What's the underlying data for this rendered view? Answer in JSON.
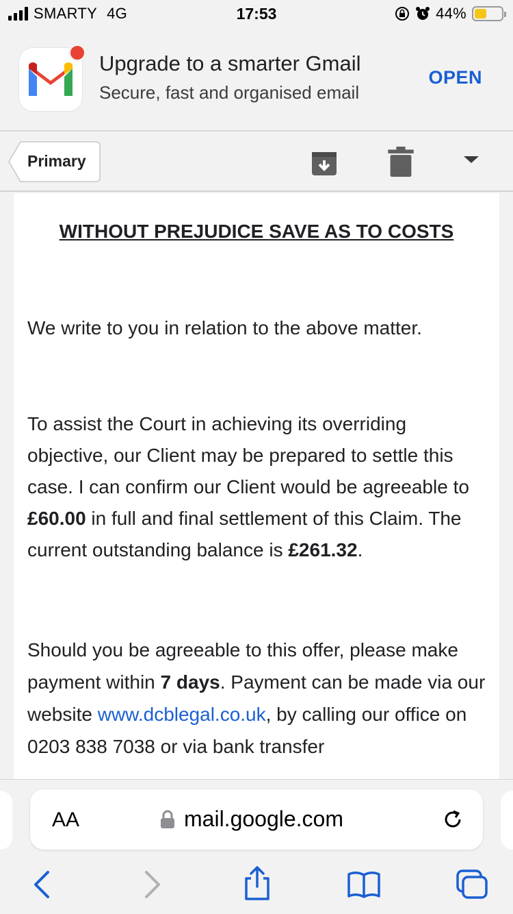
{
  "status": {
    "carrier": "SMARTY",
    "network": "4G",
    "time": "17:53",
    "battery": "44%",
    "battery_level": 0.44
  },
  "banner": {
    "title": "Upgrade to a smarter Gmail",
    "subtitle": "Secure, fast and organised email",
    "open_label": "OPEN"
  },
  "toolbar": {
    "back_label": "Primary"
  },
  "email": {
    "heading": "WITHOUT PREJUDICE SAVE AS TO COSTS",
    "p1": "We write to you in relation to the above matter.",
    "p2": {
      "a": "To assist the Court in achieving its overriding objective, our Client may be prepared to settle this case. I can confirm our Client would be agreeable to ",
      "amount": "£60.00",
      "b": " in full and final settlement of this Claim. The current outstanding balance is ",
      "balance": "£261.32",
      "c": "."
    },
    "p3": {
      "a": "Should you be agreeable to this offer, please make payment within ",
      "days": "7 days",
      "b": ". Payment can be made via our website ",
      "link": "www.dcblegal.co.uk",
      "c": ", by calling our office on 0203 838 7038 or via bank transfer"
    }
  },
  "browser": {
    "aa_label": "AA",
    "url": "mail.google.com"
  },
  "colors": {
    "accent": "#1a5fd3",
    "gmail_red": "#ea4335",
    "gmail_blue": "#4285f4",
    "gmail_green": "#34a853",
    "gmail_yellow": "#fbbc04"
  }
}
